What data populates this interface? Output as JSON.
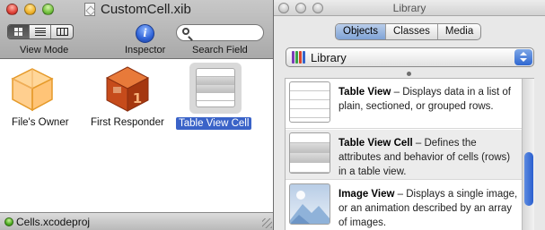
{
  "xib_window": {
    "title": "CustomCell.xib",
    "toolbar": {
      "view_mode_label": "View Mode",
      "inspector_label": "Inspector",
      "search_label": "Search Field",
      "search_placeholder": ""
    },
    "objects": [
      {
        "label": "File's Owner",
        "icon": "cube-icon"
      },
      {
        "label": "First Responder",
        "icon": "first-responder-icon"
      },
      {
        "label": "Table View Cell",
        "icon": "table-view-cell-icon",
        "selected": true
      }
    ],
    "status": {
      "text": "Cells.xcodeproj"
    }
  },
  "library_window": {
    "title": "Library",
    "tabs": [
      {
        "label": "Objects",
        "active": true
      },
      {
        "label": "Classes",
        "active": false
      },
      {
        "label": "Media",
        "active": false
      }
    ],
    "popup": {
      "label": "Library"
    },
    "items": [
      {
        "name": "Table View",
        "description": "Displays data in a list of plain, sectioned, or grouped rows."
      },
      {
        "name": "Table View Cell",
        "description": "Defines the attributes and behavior of cells (rows) in a table view."
      },
      {
        "name": "Image View",
        "description": "Displays a single image, or an animation described by an array of images."
      }
    ]
  },
  "colors": {
    "selection": "#3a63c8",
    "accent_blue": "#2f67d1"
  }
}
